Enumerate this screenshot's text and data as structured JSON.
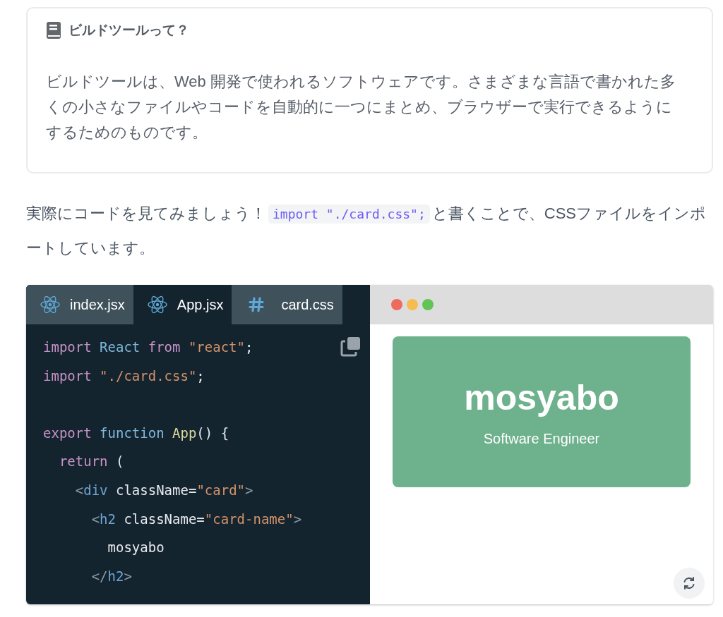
{
  "note": {
    "title": "ビルドツールって？",
    "body": "ビルドツールは、Web 開発で使われるソフトウェアです。さまざまな言語で書かれた多くの小さなファイルやコードを自動的に一つにまとめ、ブラウザーで実行できるようにするためのものです。"
  },
  "paragraph": [
    {
      "kind": "text",
      "text": "実際にコードを見てみましょう！"
    },
    {
      "kind": "code",
      "text": "import \"./card.css\";"
    },
    {
      "kind": "text",
      "text": "と書くことで、CSSファイルをインポートしています。"
    }
  ],
  "editor": {
    "tabs": [
      {
        "label": "index.jsx",
        "kind": "react",
        "selected": false
      },
      {
        "label": "App.jsx",
        "kind": "react",
        "selected": true
      },
      {
        "label": "card.css",
        "kind": "css",
        "selected": false
      }
    ],
    "lines": [
      {
        "kind": "code",
        "tokens": [
          {
            "kind": "keyword",
            "text": "import"
          },
          {
            "kind": "name",
            "text": " React"
          },
          {
            "kind": "keyword",
            "text": " from"
          },
          {
            "kind": "string",
            "text": " \"react\""
          },
          {
            "kind": "plain",
            "text": ";"
          }
        ]
      },
      {
        "kind": "code",
        "tokens": [
          {
            "kind": "keyword",
            "text": "import"
          },
          {
            "kind": "string",
            "text": " \"./card.css\""
          },
          {
            "kind": "plain",
            "text": ";"
          }
        ]
      },
      {
        "kind": "blank"
      },
      {
        "kind": "code",
        "tokens": [
          {
            "kind": "keyword",
            "text": "export"
          },
          {
            "kind": "name",
            "text": " function"
          },
          {
            "kind": "func",
            "text": " App"
          },
          {
            "kind": "plain",
            "text": "() {"
          }
        ]
      },
      {
        "kind": "code",
        "tokens": [
          {
            "kind": "keyword",
            "text": "  return"
          },
          {
            "kind": "plain",
            "text": " ("
          }
        ]
      },
      {
        "kind": "code",
        "tokens": [
          {
            "kind": "punct",
            "text": "    <"
          },
          {
            "kind": "tag",
            "text": "div"
          },
          {
            "kind": "plain",
            "text": " className="
          },
          {
            "kind": "string",
            "text": "\"card\""
          },
          {
            "kind": "punct",
            "text": ">"
          }
        ]
      },
      {
        "kind": "code",
        "tokens": [
          {
            "kind": "punct",
            "text": "      <"
          },
          {
            "kind": "tag",
            "text": "h2"
          },
          {
            "kind": "plain",
            "text": " className="
          },
          {
            "kind": "string",
            "text": "\"card-name\""
          },
          {
            "kind": "punct",
            "text": ">"
          }
        ]
      },
      {
        "kind": "code",
        "tokens": [
          {
            "kind": "plain",
            "text": "        mosyabo"
          }
        ]
      },
      {
        "kind": "code",
        "tokens": [
          {
            "kind": "punct",
            "text": "      </"
          },
          {
            "kind": "tag",
            "text": "h2"
          },
          {
            "kind": "punct",
            "text": ">"
          }
        ]
      }
    ]
  },
  "preview": {
    "dots": [
      {
        "color": "#ee6a5e"
      },
      {
        "color": "#f5bd4f"
      },
      {
        "color": "#61c454"
      }
    ],
    "card": {
      "name": "mosyabo",
      "title": "Software Engineer"
    }
  }
}
